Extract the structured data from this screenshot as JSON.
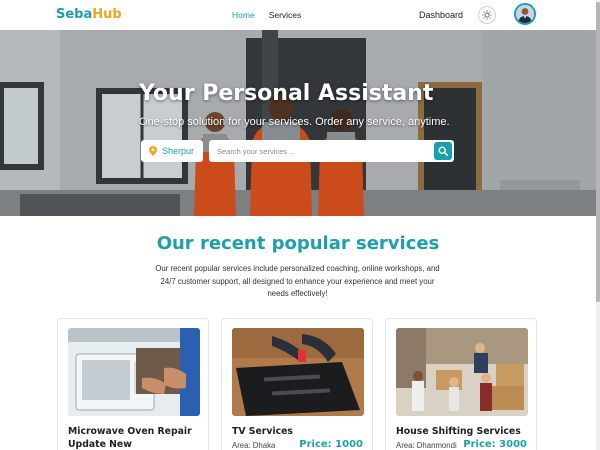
{
  "brand": {
    "part1": "Seba",
    "part2": "Hub"
  },
  "nav": {
    "home": "Home",
    "services": "Services"
  },
  "header": {
    "dashboard": "Dashboard"
  },
  "hero": {
    "title": "Your Personal Assistant",
    "subtitle": "One-stop solution for your services. Order any service, anytime.",
    "location": "Sherpur",
    "search_placeholder": "Search your services ..."
  },
  "popular": {
    "title": "Our recent popular services",
    "description": "Our recent popular services include personalized coaching, online workshops, and 24/7 customer support, all designed to enhance your experience and meet your needs effectively!"
  },
  "cards": [
    {
      "title": "Microwave Oven Repair Update New",
      "area": "",
      "price": ""
    },
    {
      "title": "TV Services",
      "area": "Area: Dhaka",
      "price": "Price: 1000"
    },
    {
      "title": "House Shifting Services",
      "area": "Area: Dhanmondi",
      "price": "Price: 3000"
    }
  ],
  "colors": {
    "accent": "#1aa0ae",
    "logo_accent": "#f2a51a",
    "uniform": "#e8561f"
  },
  "icons": [
    "sun-icon",
    "avatar",
    "location-pin-icon",
    "search-icon"
  ]
}
